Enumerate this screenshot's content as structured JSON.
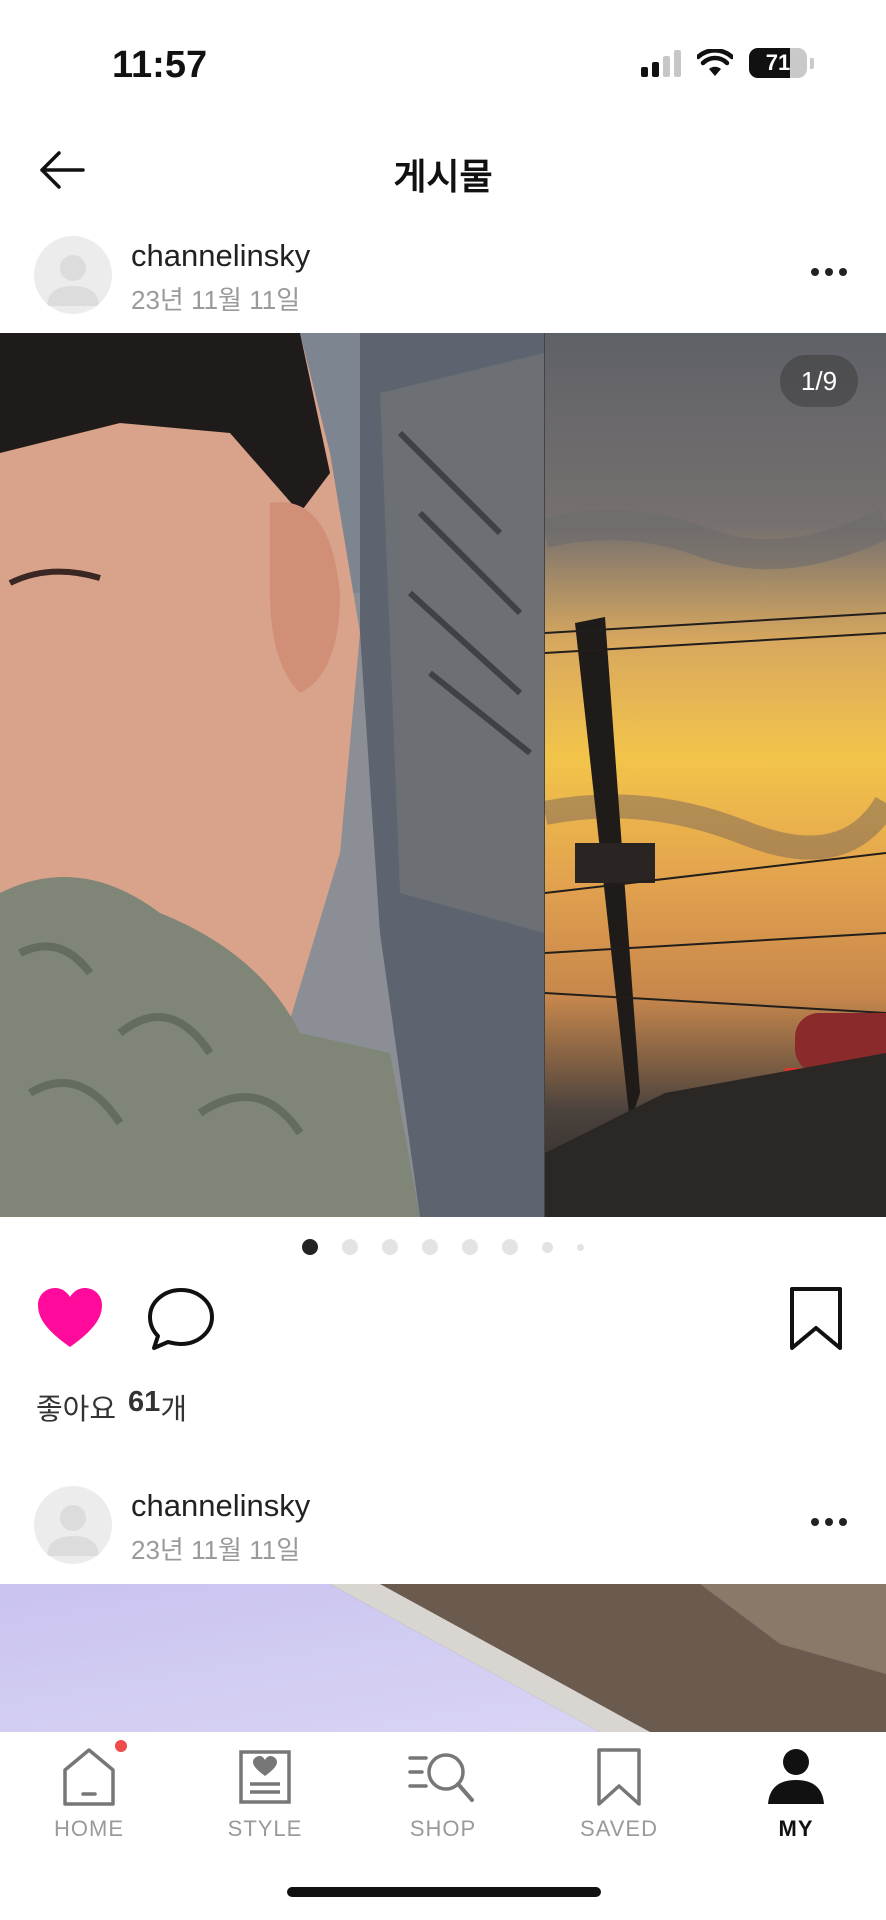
{
  "status_bar": {
    "time": "11:57",
    "battery": "71",
    "battery_level": 0.71
  },
  "header": {
    "title": "게시물",
    "back_icon": "arrow-left-icon"
  },
  "posts": [
    {
      "username": "channelinsky",
      "date": "23년 11월 11일",
      "counter": "1/9",
      "likes_label": "좋아요",
      "likes_count": "61",
      "likes_suffix": "개",
      "liked": true,
      "current_slide": 1,
      "total_slides": 9
    },
    {
      "username": "channelinsky",
      "date": "23년 11월 11일"
    }
  ],
  "colors": {
    "like": "#ff0a9b",
    "badge": "#ef4b4b",
    "text": "#222222",
    "muted": "#9a9a9a"
  },
  "nav": {
    "items": [
      {
        "label": "HOME",
        "icon": "home-icon",
        "badge": true
      },
      {
        "label": "STYLE",
        "icon": "style-icon"
      },
      {
        "label": "SHOP",
        "icon": "shop-search-icon"
      },
      {
        "label": "SAVED",
        "icon": "bookmark-icon"
      },
      {
        "label": "MY",
        "icon": "profile-icon",
        "active": true
      }
    ]
  }
}
